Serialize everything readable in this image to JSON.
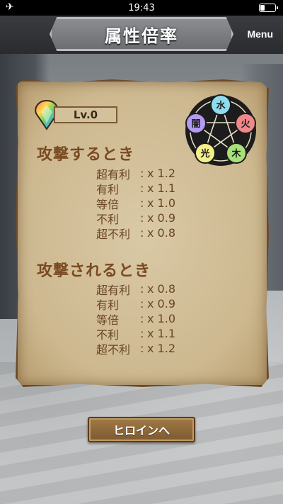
{
  "status_bar": {
    "time": "19:43"
  },
  "header": {
    "title": "属性倍率",
    "menu_label": "Menu"
  },
  "level": {
    "label": "Lv.0"
  },
  "element_wheel": {
    "elements": [
      {
        "name": "水",
        "color": "#8fdcef"
      },
      {
        "name": "火",
        "color": "#f0888a"
      },
      {
        "name": "木",
        "color": "#a8e07a"
      },
      {
        "name": "光",
        "color": "#f3f08a"
      },
      {
        "name": "闇",
        "color": "#b49af0"
      }
    ]
  },
  "attacking": {
    "heading": "攻撃するとき",
    "rows": [
      {
        "label": "超有利",
        "sep": ":",
        "value": "x 1.2"
      },
      {
        "label": "有利",
        "sep": ":",
        "value": "x 1.1"
      },
      {
        "label": "等倍",
        "sep": ":",
        "value": "x 1.0"
      },
      {
        "label": "不利",
        "sep": ":",
        "value": "x 0.9"
      },
      {
        "label": "超不利",
        "sep": ":",
        "value": "x 0.8"
      }
    ]
  },
  "defending": {
    "heading": "攻撃されるとき",
    "rows": [
      {
        "label": "超有利",
        "sep": ":",
        "value": "x 0.8"
      },
      {
        "label": "有利",
        "sep": ":",
        "value": "x 0.9"
      },
      {
        "label": "等倍",
        "sep": ":",
        "value": "x 1.0"
      },
      {
        "label": "不利",
        "sep": ":",
        "value": "x 1.1"
      },
      {
        "label": "超不利",
        "sep": ":",
        "value": "x 1.2"
      }
    ]
  },
  "heroine_button": {
    "label": "ヒロインへ"
  },
  "colors": {
    "parchment": "#d2bf97",
    "heading_text": "#7a4a22",
    "header_bar": "#2a2b2e"
  }
}
